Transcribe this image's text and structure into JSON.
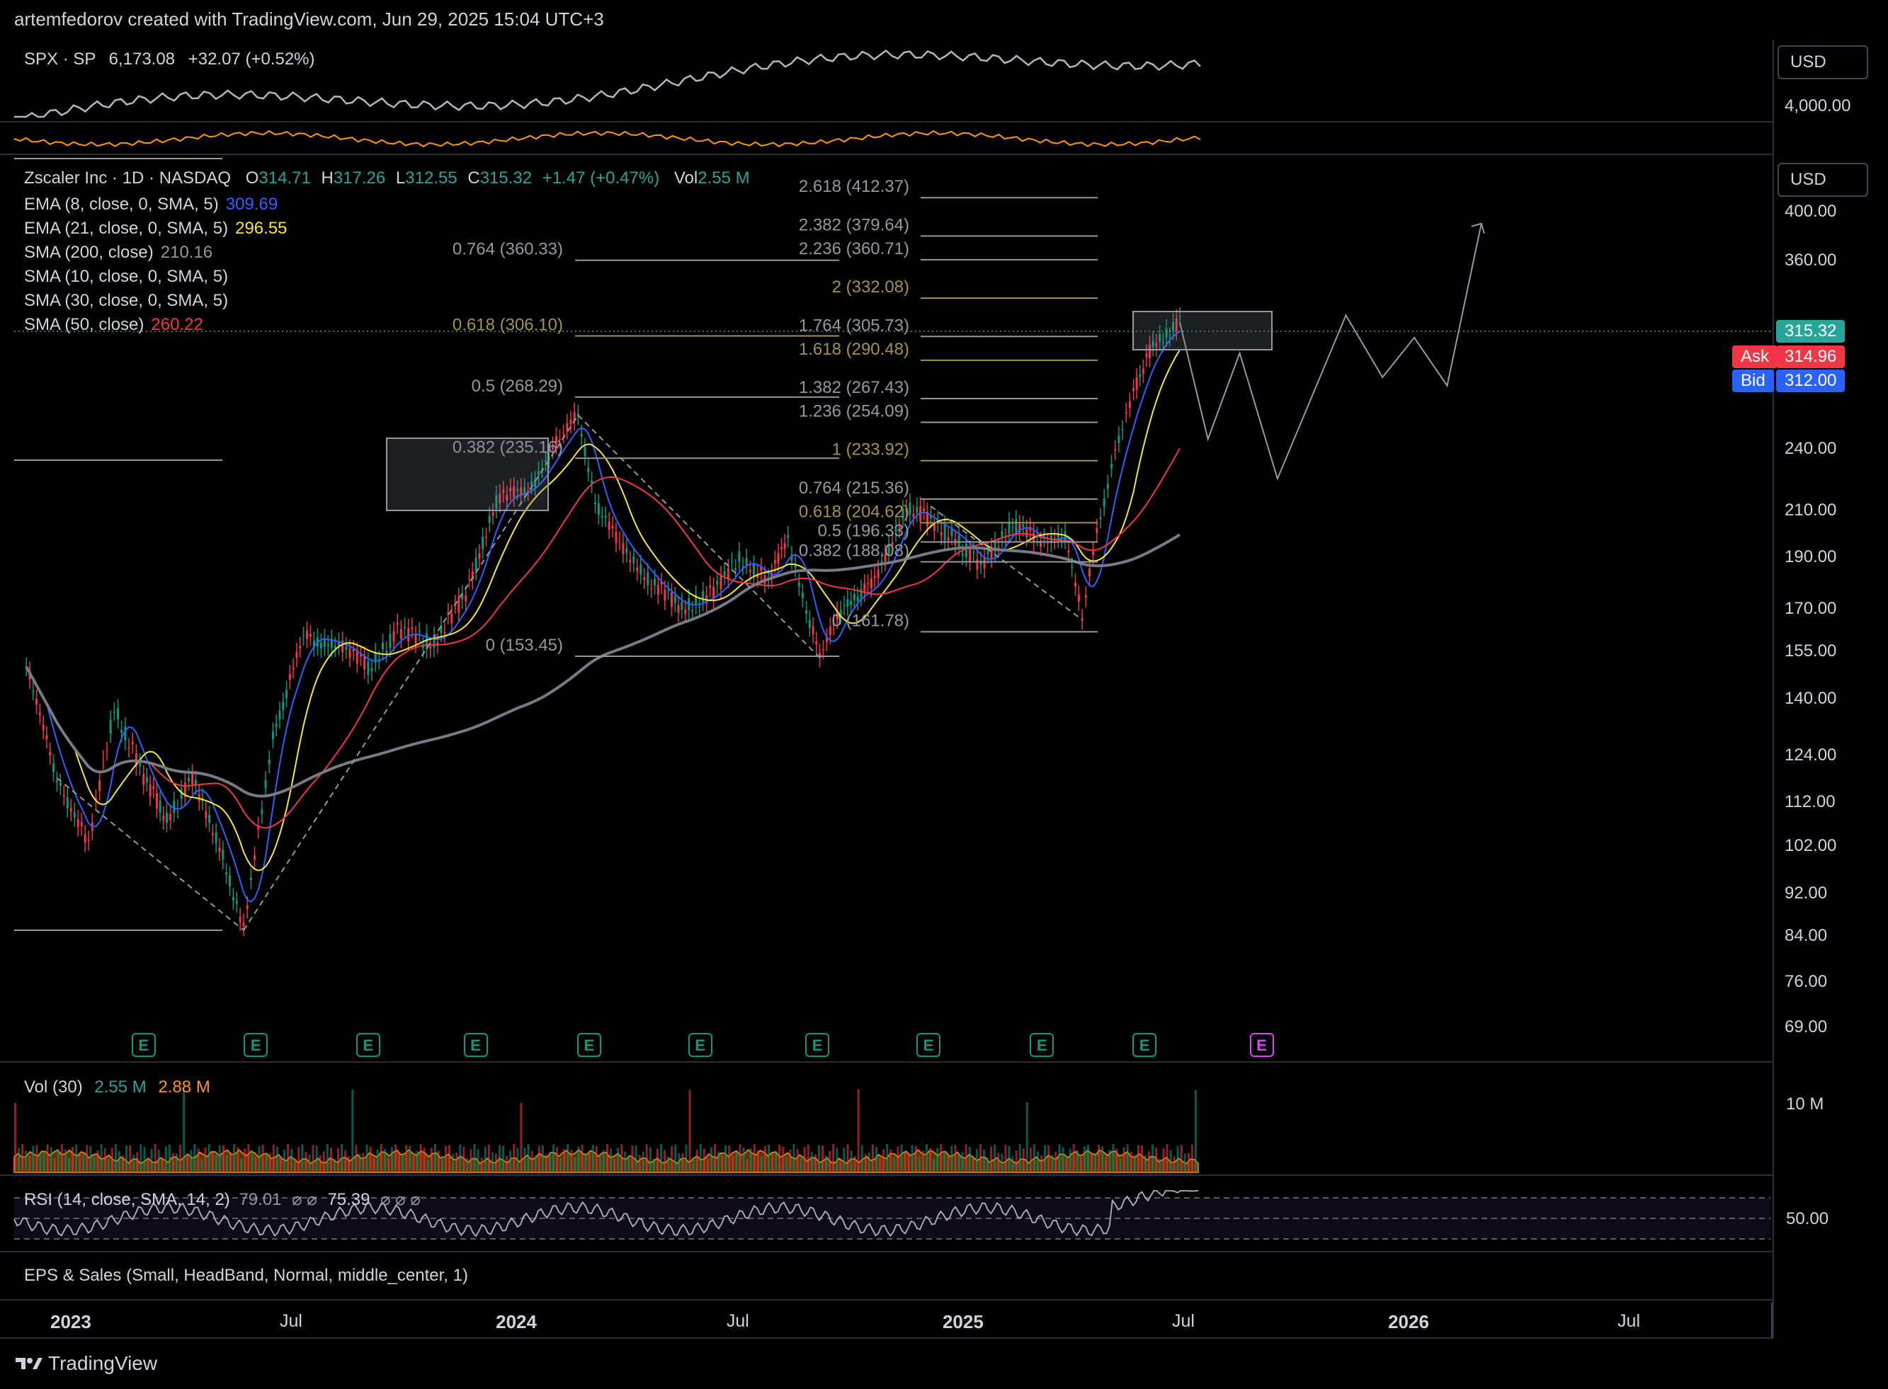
{
  "header": {
    "caption": "artemfedorov created with TradingView.com, Jun 29, 2025 15:04 UTC+3"
  },
  "spx": {
    "symbol": "SPX · SP",
    "price": "6,173.08",
    "change": "+32.07 (+0.52%)",
    "axis_label": "4,000.00",
    "currency": "USD"
  },
  "main": {
    "title": "Zscaler Inc · 1D · NASDAQ",
    "ohlc": {
      "o_label": "O",
      "o": "314.71",
      "h_label": "H",
      "h": "317.26",
      "l_label": "L",
      "l": "312.55",
      "c_label": "C",
      "c": "315.32",
      "chg": "+1.47 (+0.47%)",
      "vol_label": "Vol",
      "vol": "2.55 M"
    },
    "currency": "USD",
    "indicators": [
      {
        "label": "EMA (8, close, 0, SMA, 5)",
        "value": "309.69",
        "color": "#2962ff"
      },
      {
        "label": "EMA (21, close, 0, SMA, 5)",
        "value": "296.55",
        "color": "#f7e733"
      },
      {
        "label": "SMA (200, close)",
        "value": "210.16",
        "color": "#9598a1"
      },
      {
        "label": "SMA (10, close, 0, SMA, 5)",
        "value": "",
        "color": "#d1d4dc"
      },
      {
        "label": "SMA (30, close, 0, SMA, 5)",
        "value": "",
        "color": "#d1d4dc"
      },
      {
        "label": "SMA (50, close)",
        "value": "260.22",
        "color": "#f23645"
      }
    ],
    "price_labels": {
      "last": "315.32",
      "ask_label": "Ask",
      "ask": "314.96",
      "bid_label": "Bid",
      "bid": "312.00"
    }
  },
  "volume": {
    "label": "Vol (30)",
    "v1": "2.55 M",
    "v2": "2.88 M",
    "axis": "10 M"
  },
  "rsi": {
    "label": "RSI (14, close, SMA, 14, 2)",
    "v1": "79.01",
    "sym": "⌀ ⌀",
    "v2": "75.39",
    "sym2": "⌀ ⌀ ⌀",
    "axis": "50.00"
  },
  "eps": {
    "label": "EPS & Sales (Small, HeadBand, Normal, middle_center, 1)"
  },
  "earnings_marker": "E",
  "branding": {
    "name": "TradingView"
  },
  "colors": {
    "up": "#089981",
    "down": "#f23645",
    "ema8": "#2962ff",
    "ema21": "#f7e733",
    "sma50": "#f23645",
    "sma200": "#787b86",
    "fib_gray": "#9598a1",
    "fib_gold": "#a39247"
  },
  "chart_data": {
    "type": "candlestick",
    "scale": "log",
    "ylim": [
      64,
      450
    ],
    "y_ticks": [
      "400.00",
      "360.00",
      "240.00",
      "210.00",
      "190.00",
      "170.00",
      "155.00",
      "140.00",
      "124.00",
      "112.00",
      "102.00",
      "92.00",
      "84.00",
      "76.00",
      "69.00"
    ],
    "x_ticks": [
      {
        "label": "2023",
        "date": "2023-01-01",
        "bold": true
      },
      {
        "label": "Jul",
        "date": "2023-07-01",
        "bold": false
      },
      {
        "label": "2024",
        "date": "2024-01-01",
        "bold": true
      },
      {
        "label": "Jul",
        "date": "2024-07-01",
        "bold": false
      },
      {
        "label": "2025",
        "date": "2025-01-01",
        "bold": true
      },
      {
        "label": "Jul",
        "date": "2025-07-01",
        "bold": false
      },
      {
        "label": "2026",
        "date": "2026-01-01",
        "bold": true
      },
      {
        "label": "Jul",
        "date": "2026-07-01",
        "bold": false
      }
    ],
    "price_path": [
      {
        "date": "2022-11-25",
        "price": 150
      },
      {
        "date": "2022-12-20",
        "price": 118
      },
      {
        "date": "2023-01-15",
        "price": 102
      },
      {
        "date": "2023-02-05",
        "price": 138
      },
      {
        "date": "2023-03-01",
        "price": 118
      },
      {
        "date": "2023-03-20",
        "price": 108
      },
      {
        "date": "2023-04-10",
        "price": 118
      },
      {
        "date": "2023-05-05",
        "price": 100
      },
      {
        "date": "2023-05-22",
        "price": 85
      },
      {
        "date": "2023-06-15",
        "price": 130
      },
      {
        "date": "2023-07-10",
        "price": 160
      },
      {
        "date": "2023-08-05",
        "price": 158
      },
      {
        "date": "2023-09-01",
        "price": 150
      },
      {
        "date": "2023-09-25",
        "price": 162
      },
      {
        "date": "2023-10-25",
        "price": 158
      },
      {
        "date": "2023-11-20",
        "price": 175
      },
      {
        "date": "2023-12-15",
        "price": 215
      },
      {
        "date": "2024-01-10",
        "price": 220
      },
      {
        "date": "2024-02-05",
        "price": 245
      },
      {
        "date": "2024-02-20",
        "price": 258
      },
      {
        "date": "2024-03-05",
        "price": 215
      },
      {
        "date": "2024-03-25",
        "price": 195
      },
      {
        "date": "2024-04-20",
        "price": 180
      },
      {
        "date": "2024-05-15",
        "price": 170
      },
      {
        "date": "2024-06-10",
        "price": 176
      },
      {
        "date": "2024-07-01",
        "price": 190
      },
      {
        "date": "2024-07-25",
        "price": 180
      },
      {
        "date": "2024-08-10",
        "price": 198
      },
      {
        "date": "2024-08-25",
        "price": 170
      },
      {
        "date": "2024-09-05",
        "price": 153
      },
      {
        "date": "2024-09-25",
        "price": 172
      },
      {
        "date": "2024-10-20",
        "price": 180
      },
      {
        "date": "2024-11-15",
        "price": 212
      },
      {
        "date": "2024-12-05",
        "price": 205
      },
      {
        "date": "2024-12-25",
        "price": 198
      },
      {
        "date": "2025-01-15",
        "price": 186
      },
      {
        "date": "2025-02-10",
        "price": 205
      },
      {
        "date": "2025-03-05",
        "price": 196
      },
      {
        "date": "2025-03-25",
        "price": 200
      },
      {
        "date": "2025-04-08",
        "price": 166
      },
      {
        "date": "2025-04-20",
        "price": 200
      },
      {
        "date": "2025-05-05",
        "price": 240
      },
      {
        "date": "2025-05-20",
        "price": 270
      },
      {
        "date": "2025-06-05",
        "price": 300
      },
      {
        "date": "2025-06-27",
        "price": 315.32
      }
    ],
    "projection": [
      {
        "date": "2025-06-27",
        "price": 315
      },
      {
        "date": "2025-07-20",
        "price": 245
      },
      {
        "date": "2025-08-15",
        "price": 295
      },
      {
        "date": "2025-09-15",
        "price": 225
      },
      {
        "date": "2025-11-10",
        "price": 320
      },
      {
        "date": "2025-12-10",
        "price": 280
      },
      {
        "date": "2026-01-05",
        "price": 305
      },
      {
        "date": "2026-02-01",
        "price": 275
      },
      {
        "date": "2026-03-01",
        "price": 390
      }
    ],
    "fib_left": {
      "levels": [
        {
          "label": "0.764 (360.33)",
          "price": 360.33,
          "color": "#9598a1"
        },
        {
          "label": "0.618 (306.10)",
          "price": 306.1,
          "color": "#a39247"
        },
        {
          "label": "0.5 (268.29)",
          "price": 268.29,
          "color": "#9598a1"
        },
        {
          "label": "0.382 (235.16)",
          "price": 235.16,
          "color": "#9598a1"
        },
        {
          "label": "0 (153.45)",
          "price": 153.45,
          "color": "#9598a1"
        }
      ]
    },
    "fib_right": {
      "levels": [
        {
          "label": "2.618 (412.37)",
          "price": 412.37,
          "color": "#9598a1"
        },
        {
          "label": "2.382 (379.64)",
          "price": 379.64,
          "color": "#9598a1"
        },
        {
          "label": "2.236 (360.71)",
          "price": 360.71,
          "color": "#9598a1"
        },
        {
          "label": "2 (332.08)",
          "price": 332.08,
          "color": "#a39247"
        },
        {
          "label": "1.764 (305.73)",
          "price": 305.73,
          "color": "#9598a1"
        },
        {
          "label": "1.618 (290.48)",
          "price": 290.48,
          "color": "#a39247"
        },
        {
          "label": "1.382 (267.43)",
          "price": 267.43,
          "color": "#9598a1"
        },
        {
          "label": "1.236 (254.09)",
          "price": 254.09,
          "color": "#9598a1"
        },
        {
          "label": "1 (233.92)",
          "price": 233.92,
          "color": "#a39247"
        }
      ]
    },
    "fib_mid": {
      "levels": [
        {
          "label": "0.764 (215.36)",
          "price": 215.36,
          "color": "#9598a1"
        },
        {
          "label": "0.618 (204.62)",
          "price": 204.62,
          "color": "#a39247"
        },
        {
          "label": "0.5 (196.33)",
          "price": 196.33,
          "color": "#9598a1"
        },
        {
          "label": "0.382 (188.08)",
          "price": 188.08,
          "color": "#9598a1"
        },
        {
          "label": "0 (161.78)",
          "price": 161.78,
          "color": "#9598a1"
        }
      ]
    },
    "earnings_dates": [
      "2023-03-01",
      "2023-06-01",
      "2023-09-01",
      "2023-11-28",
      "2024-02-29",
      "2024-05-30",
      "2024-09-03",
      "2024-12-03",
      "2025-03-06",
      "2025-05-29"
    ],
    "future_earnings_date": "2025-09-02"
  }
}
